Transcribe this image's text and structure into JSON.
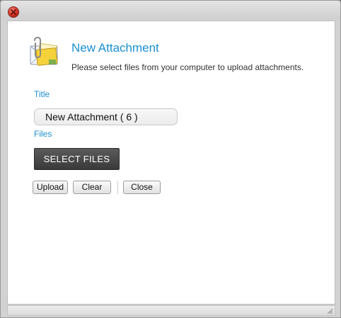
{
  "dialog": {
    "heading": "New Attachment",
    "instruction": "Please select files from your computer to upload attachments.",
    "icon": "attachment-envelope-icon"
  },
  "form": {
    "title_label": "Title",
    "title_value": "New Attachment ( 6 )",
    "files_label": "Files",
    "select_files_label": "SELECT FILES"
  },
  "actions": {
    "upload_label": "Upload",
    "clear_label": "Clear",
    "close_label": "Close"
  },
  "colors": {
    "accent": "#1a8fd0",
    "close_button": "#c8281a",
    "select_button": "#3a3a3a"
  }
}
